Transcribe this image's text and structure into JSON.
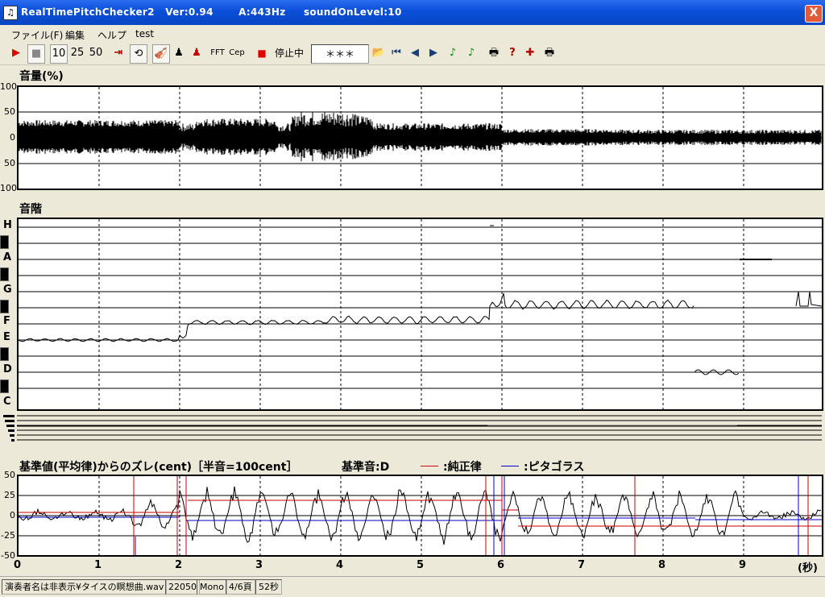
{
  "titlebar": {
    "icon": "♫",
    "title": "RealTimePitchChecker2   Ver:0.94       A:443Hz     soundOnLevel:10",
    "close": "X"
  },
  "menu": [
    {
      "label": "ファイル(F)"
    },
    {
      "label": "編集"
    },
    {
      "label": "ヘルプ"
    },
    {
      "label": "test"
    }
  ],
  "toolbar": {
    "play_icon": "▶",
    "stop_icon": "■",
    "zoom_10": "10",
    "zoom_25": "25",
    "zoom_50": "50",
    "to_end_icon": "⇥",
    "repeat_icon": "⟲",
    "violin_icon": "🎻",
    "person1_icon": "♟",
    "person2_icon": "♟",
    "fft_label": "FFT",
    "cep_label": "Cep",
    "rec_icon": "■",
    "status": "停止中",
    "display": "＊＊＊",
    "open_icon": "📂",
    "first_icon": "⏮",
    "prev_icon": "◀",
    "next_icon": "▶",
    "note1_icon": "♪",
    "note2_icon": "♪",
    "print_icon": "🖶",
    "help_icon": "?",
    "cursor_icon": "✚",
    "print2_icon": "🖶"
  },
  "volume_panel": {
    "label": "音量(%)",
    "yticks": [
      "100",
      "50",
      "0",
      "50",
      "100"
    ]
  },
  "scale_panel": {
    "label": "音階",
    "notes": [
      "H",
      "A",
      "G",
      "F",
      "E",
      "D",
      "C"
    ]
  },
  "deviation_panel": {
    "label": "基準値(平均律)からのズレ(cent)［半音=100cent］",
    "base_tone": "基準音:D",
    "legend_just": ":純正律",
    "legend_pyth": ":ピタゴラス",
    "yticks": [
      "50",
      "25",
      "0",
      "-25",
      "-50"
    ],
    "colors": {
      "just": "#cc0000",
      "pyth": "#0000cc"
    }
  },
  "xaxis": {
    "ticks": [
      "0",
      "1",
      "2",
      "3",
      "4",
      "5",
      "6",
      "7",
      "8",
      "9"
    ],
    "unit": "(秒)"
  },
  "statusbar": {
    "file": "演奏者名は非表示¥タイスの瞑想曲.wav",
    "rate": "22050",
    "channel": "Mono",
    "page": "4/6頁",
    "duration": "52秒"
  }
}
